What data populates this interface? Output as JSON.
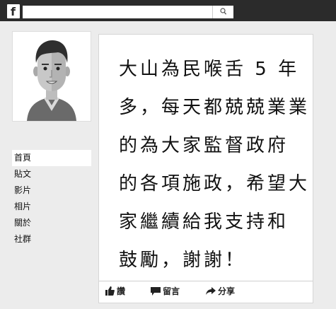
{
  "header": {
    "logo_letter": "f",
    "search_placeholder": ""
  },
  "sidebar": {
    "items": [
      {
        "label": "首頁",
        "active": true
      },
      {
        "label": "貼文",
        "active": false
      },
      {
        "label": "影片",
        "active": false
      },
      {
        "label": "相片",
        "active": false
      },
      {
        "label": "關於",
        "active": false
      },
      {
        "label": "社群",
        "active": false
      }
    ]
  },
  "post": {
    "lines": [
      "大山為民喉舌 5 年",
      "多，每天都兢兢業業",
      "的為大家監督政府",
      "的各項施政，希望大",
      "家繼續給我支持和",
      "鼓勵，謝謝！"
    ],
    "actions": {
      "like_label": "讚",
      "comment_label": "留言",
      "share_label": "分享"
    }
  },
  "colors": {
    "topbar": "#2b2b2b",
    "background": "#ececec",
    "card": "#ffffff"
  }
}
